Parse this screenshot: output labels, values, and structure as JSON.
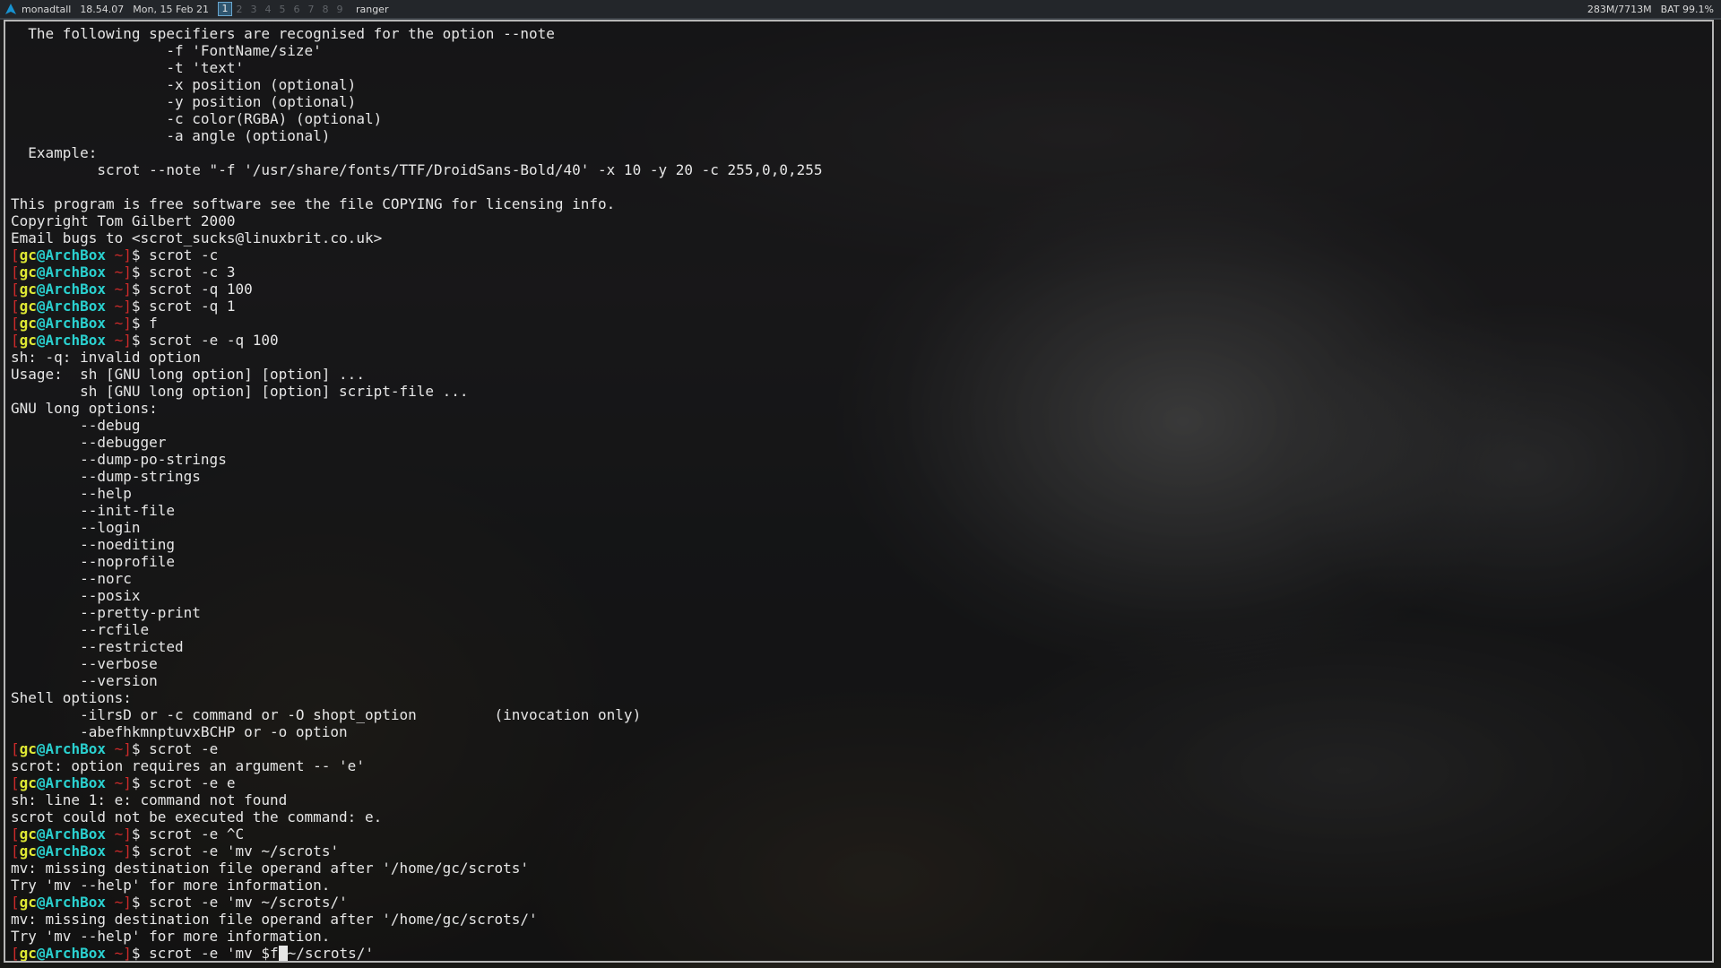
{
  "topbar": {
    "host": "monadtall",
    "time": "18.54.07",
    "date": "Mon, 15 Feb 21",
    "groups": [
      "1",
      "2",
      "3",
      "4",
      "5",
      "6",
      "7",
      "8",
      "9"
    ],
    "active_group": "1",
    "window_title": "ranger",
    "memory": "283M/7713M",
    "battery": "BAT 99.1%"
  },
  "colors": {
    "prompt_bracket": "#cc2a2a",
    "prompt_user": "#dfe834",
    "prompt_host": "#2ad0cf",
    "terminal_text": "#e6e6e6",
    "active_group_bg": "#2f5670"
  },
  "terminal": {
    "prompt": {
      "open": "[",
      "user": "gc",
      "at": "@",
      "host": "ArchBox",
      "path": " ~",
      "close": "]",
      "dollar": "$ "
    },
    "lines": [
      {
        "text": "  The following specifiers are recognised for the option --note"
      },
      {
        "text": "                  -f 'FontName/size'"
      },
      {
        "text": "                  -t 'text'"
      },
      {
        "text": "                  -x position (optional)"
      },
      {
        "text": "                  -y position (optional)"
      },
      {
        "text": "                  -c color(RGBA) (optional)"
      },
      {
        "text": "                  -a angle (optional)"
      },
      {
        "text": "  Example:"
      },
      {
        "text": "          scrot --note \"-f '/usr/share/fonts/TTF/DroidSans-Bold/40' -x 10 -y 20 -c 255,0,0,255"
      },
      {
        "text": ""
      },
      {
        "text": "This program is free software see the file COPYING for licensing info."
      },
      {
        "text": "Copyright Tom Gilbert 2000"
      },
      {
        "text": "Email bugs to <scrot_sucks@linuxbrit.co.uk>"
      },
      {
        "prompt": true,
        "cmd": "scrot -c"
      },
      {
        "prompt": true,
        "cmd": "scrot -c 3"
      },
      {
        "prompt": true,
        "cmd": "scrot -q 100"
      },
      {
        "prompt": true,
        "cmd": "scrot -q 1"
      },
      {
        "prompt": true,
        "cmd": "f"
      },
      {
        "prompt": true,
        "cmd": "scrot -e -q 100"
      },
      {
        "text": "sh: -q: invalid option"
      },
      {
        "text": "Usage:  sh [GNU long option] [option] ..."
      },
      {
        "text": "        sh [GNU long option] [option] script-file ..."
      },
      {
        "text": "GNU long options:"
      },
      {
        "text": "        --debug"
      },
      {
        "text": "        --debugger"
      },
      {
        "text": "        --dump-po-strings"
      },
      {
        "text": "        --dump-strings"
      },
      {
        "text": "        --help"
      },
      {
        "text": "        --init-file"
      },
      {
        "text": "        --login"
      },
      {
        "text": "        --noediting"
      },
      {
        "text": "        --noprofile"
      },
      {
        "text": "        --norc"
      },
      {
        "text": "        --posix"
      },
      {
        "text": "        --pretty-print"
      },
      {
        "text": "        --rcfile"
      },
      {
        "text": "        --restricted"
      },
      {
        "text": "        --verbose"
      },
      {
        "text": "        --version"
      },
      {
        "text": "Shell options:"
      },
      {
        "text": "        -ilrsD or -c command or -O shopt_option         (invocation only)"
      },
      {
        "text": "        -abefhkmnptuvxBCHP or -o option"
      },
      {
        "prompt": true,
        "cmd": "scrot -e"
      },
      {
        "text": "scrot: option requires an argument -- 'e'"
      },
      {
        "prompt": true,
        "cmd": "scrot -e e"
      },
      {
        "text": "sh: line 1: e: command not found"
      },
      {
        "text": "scrot could not be executed the command: e."
      },
      {
        "prompt": true,
        "cmd": "scrot -e ^C"
      },
      {
        "prompt": true,
        "cmd": "scrot -e 'mv ~/scrots'"
      },
      {
        "text": "mv: missing destination file operand after '/home/gc/scrots'"
      },
      {
        "text": "Try 'mv --help' for more information."
      },
      {
        "prompt": true,
        "cmd": "scrot -e 'mv ~/scrots/'"
      },
      {
        "text": "mv: missing destination file operand after '/home/gc/scrots/'"
      },
      {
        "text": "Try 'mv --help' for more information."
      }
    ],
    "current_input": {
      "before_cursor": "scrot -e 'mv $f",
      "after_cursor": "~/scrots/'"
    }
  }
}
